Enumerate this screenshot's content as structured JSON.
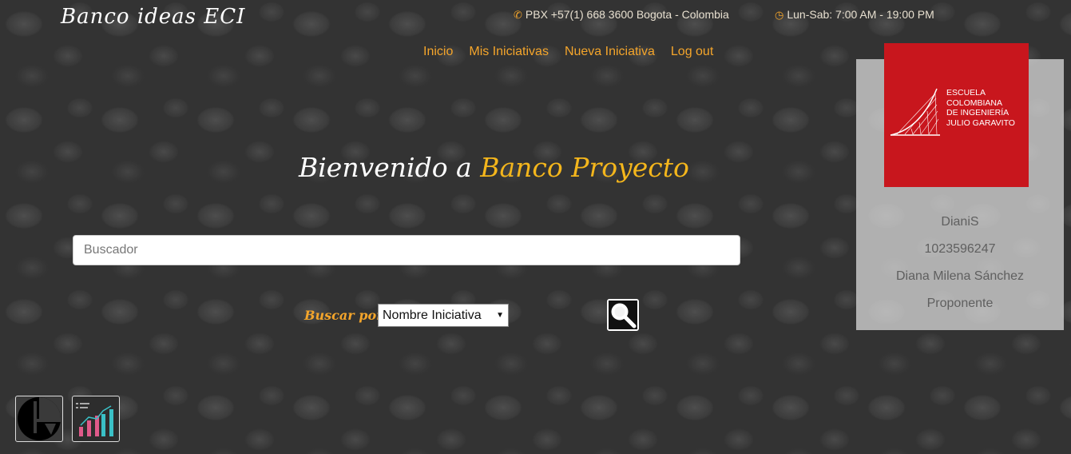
{
  "header": {
    "brand": "Banco ideas ECI",
    "phone": "PBX +57(1) 668 3600 Bogota - Colombia",
    "hours": "Lun-Sab: 7:00 AM - 19:00 PM",
    "phone_icon": "phone-icon",
    "clock_icon": "clock-icon"
  },
  "nav": {
    "items": [
      {
        "label": "Inicio"
      },
      {
        "label": "Mis Iniciativas"
      },
      {
        "label": "Nueva Iniciativa"
      },
      {
        "label": "Log out"
      }
    ]
  },
  "main": {
    "welcome_prefix": "Bienvenido a",
    "welcome_highlight": "Banco Proyecto",
    "search_placeholder": "Buscador",
    "search_value": "",
    "buscar_label": "Buscar por:",
    "selected_option": "Nombre Iniciativa",
    "search_button_icon": "magnifier-icon"
  },
  "sidebar": {
    "logo_lines": [
      "ESCUELA",
      "COLOMBIANA",
      "DE INGENIERÍA",
      "JULIO GARAVITO"
    ],
    "username": "DianiS",
    "document_id": "1023596247",
    "full_name": "Diana Milena Sánchez",
    "role": "Proponente"
  },
  "tools": [
    {
      "icon": "circle-logo-icon"
    },
    {
      "icon": "bar-chart-icon"
    }
  ],
  "colors": {
    "accent": "#f4a52b",
    "highlight": "#f4b61c",
    "logo_red": "#c8161d"
  }
}
